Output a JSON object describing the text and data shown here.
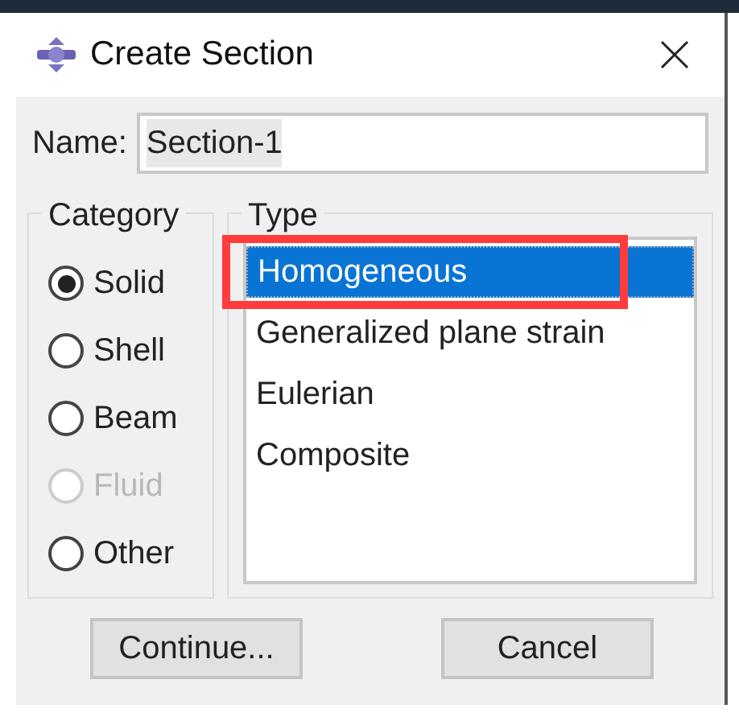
{
  "window": {
    "title": "Create Section"
  },
  "name_field": {
    "label": "Name:",
    "value": "Section-1"
  },
  "category": {
    "title": "Category",
    "options": [
      {
        "label": "Solid",
        "selected": true,
        "disabled": false
      },
      {
        "label": "Shell",
        "selected": false,
        "disabled": false
      },
      {
        "label": "Beam",
        "selected": false,
        "disabled": false
      },
      {
        "label": "Fluid",
        "selected": false,
        "disabled": true
      },
      {
        "label": "Other",
        "selected": false,
        "disabled": false
      }
    ]
  },
  "type": {
    "title": "Type",
    "items": [
      {
        "label": "Homogeneous",
        "selected": true
      },
      {
        "label": "Generalized plane strain",
        "selected": false
      },
      {
        "label": "Eulerian",
        "selected": false
      },
      {
        "label": "Composite",
        "selected": false
      }
    ]
  },
  "buttons": [
    "Continue...",
    "Cancel"
  ]
}
